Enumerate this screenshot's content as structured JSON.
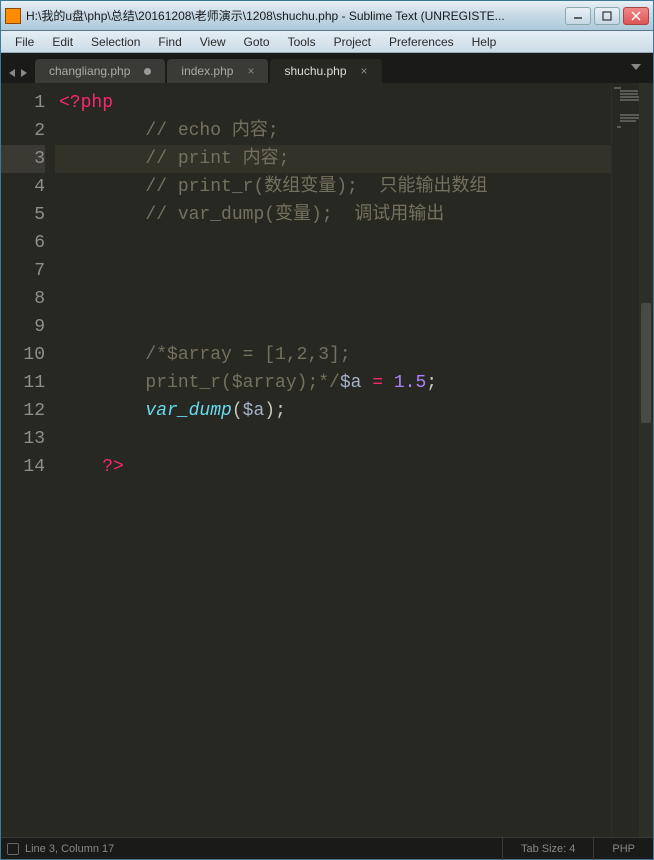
{
  "window": {
    "title": "H:\\我的u盘\\php\\总结\\20161208\\老师演示\\1208\\shuchu.php - Sublime Text (UNREGISTE..."
  },
  "menus": {
    "file": "File",
    "edit": "Edit",
    "selection": "Selection",
    "find": "Find",
    "view": "View",
    "goto": "Goto",
    "tools": "Tools",
    "project": "Project",
    "preferences": "Preferences",
    "help": "Help"
  },
  "tabs": [
    {
      "label": "changliang.php",
      "dirty": true,
      "active": false
    },
    {
      "label": "index.php",
      "dirty": false,
      "active": false
    },
    {
      "label": "shuchu.php",
      "dirty": false,
      "active": true
    }
  ],
  "code": {
    "l1_tag": "<?php",
    "l2_c": "// echo 内容;",
    "l3_c": "// print 内容;",
    "l4_c": "// print_r(数组变量);  只能输出数组",
    "l5_c": "// var_dump(变量);  调试用输出",
    "l10_c": "/*$array = [1,2,3];",
    "l11_c": "print_r($array);*/",
    "l11_var": "$a",
    "l11_eq": " = ",
    "l11_num": "1.5",
    "l11_semicolon": ";",
    "l12_func": "var_dump",
    "l12_open": "(",
    "l12_var": "$a",
    "l12_close": ")",
    "l12_semicolon": ";",
    "l14_tag": "?>",
    "indent1": "    ",
    "indent2": "        "
  },
  "linenos": [
    "1",
    "2",
    "3",
    "4",
    "5",
    "6",
    "7",
    "8",
    "9",
    "10",
    "11",
    "12",
    "13",
    "14"
  ],
  "status": {
    "position": "Line 3, Column 17",
    "tabsize": "Tab Size: 4",
    "language": "PHP"
  }
}
